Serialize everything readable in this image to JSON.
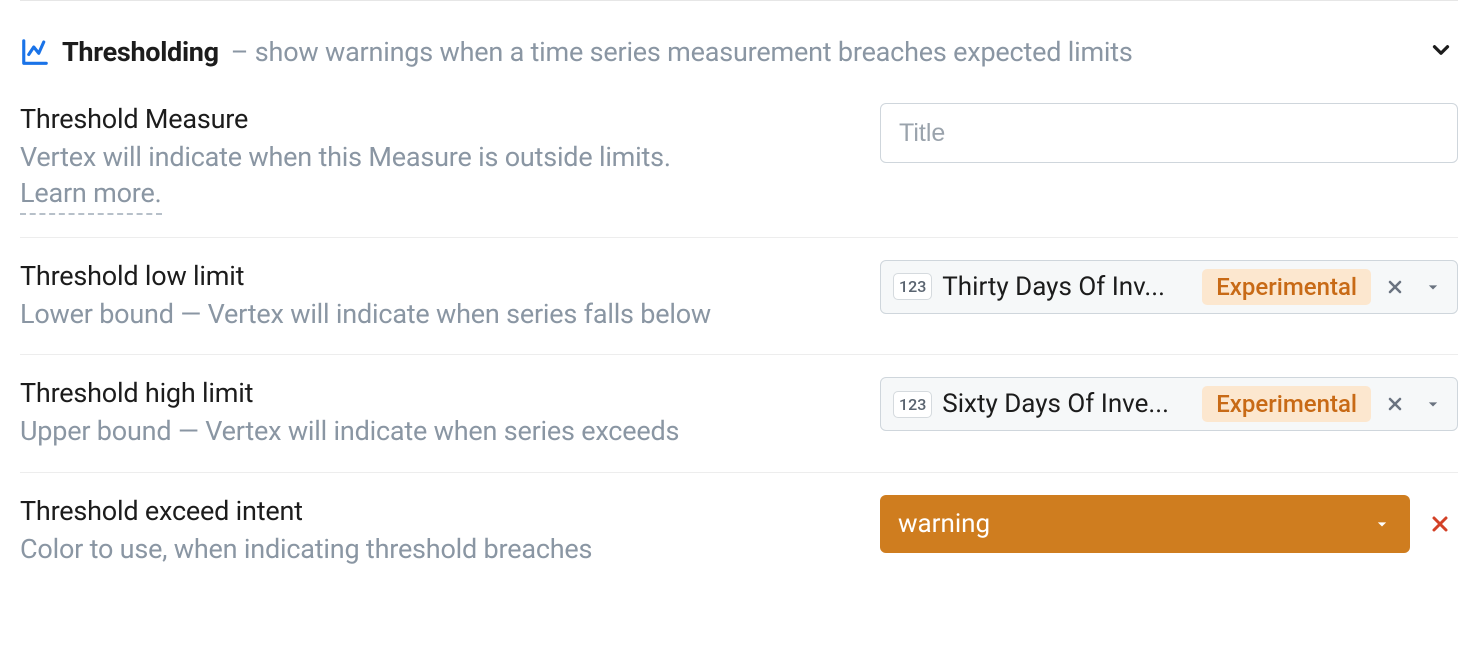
{
  "section": {
    "title": "Thresholding",
    "desc": "– show warnings when a time series measurement breaches expected limits"
  },
  "rows": {
    "measure": {
      "label": "Threshold Measure",
      "help": "Vertex will indicate when this Measure is outside limits.",
      "learn": "Learn more.",
      "placeholder": "Title",
      "value": ""
    },
    "low": {
      "label": "Threshold low limit",
      "help": "Lower bound — Vertex will indicate when series falls below",
      "chip": "123",
      "value": "Thirty Days Of Inv...",
      "tag": "Experimental"
    },
    "high": {
      "label": "Threshold high limit",
      "help": "Upper bound — Vertex will indicate when series exceeds",
      "chip": "123",
      "value": "Sixty Days Of Inve...",
      "tag": "Experimental"
    },
    "intent": {
      "label": "Threshold exceed intent",
      "help": "Color to use, when indicating threshold breaches",
      "value": "warning"
    }
  }
}
